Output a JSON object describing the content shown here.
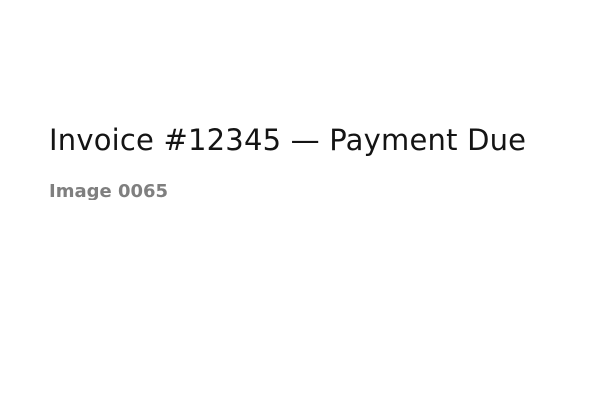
{
  "heading": {
    "text": "Invoice #12345 — Payment Due"
  },
  "caption": {
    "text": "Image 0065"
  },
  "colors": {
    "background": "#ffffff",
    "heading": "#141414",
    "caption": "#7f7f7f"
  }
}
